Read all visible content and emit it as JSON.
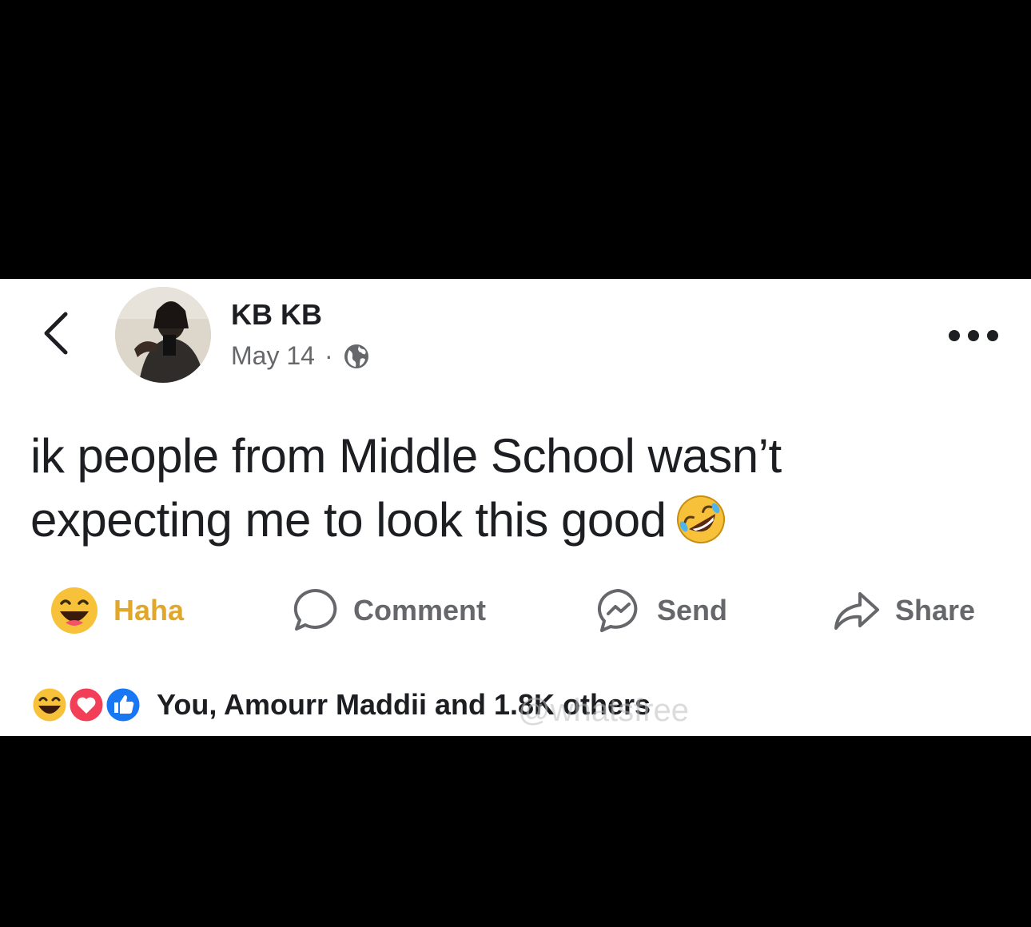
{
  "post": {
    "author_name": "KB KB",
    "date": "May 14",
    "separator": "·",
    "privacy_icon": "globe-icon",
    "text_line_1": "ik people from Middle School wasn’t",
    "text_line_2": "expecting me to look this good",
    "emoji": "rolling-on-floor-laughing-emoji"
  },
  "actions": {
    "reaction_label": "Haha",
    "comment_label": "Comment",
    "send_label": "Send",
    "share_label": "Share"
  },
  "reactions": {
    "icons": [
      "haha-icon",
      "love-icon",
      "like-icon"
    ],
    "summary_text": "You, Amourr Maddii and",
    "count_text": "1.8K others"
  },
  "watermark": "@whatsfree",
  "colors": {
    "background": "#000000",
    "card": "#ffffff",
    "text": "#1c1e21",
    "secondary": "#65676b",
    "haha": "#e0a72a",
    "love": "#f33e58",
    "like": "#1877f2"
  }
}
